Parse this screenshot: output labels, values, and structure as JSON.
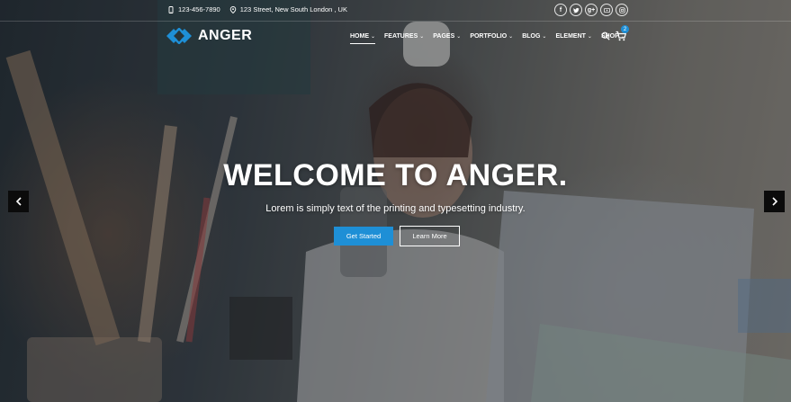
{
  "topbar": {
    "phone": "123-456-7890",
    "address": "123 Street, New South London , UK",
    "social": [
      {
        "icon": "facebook-icon",
        "glyph": "f"
      },
      {
        "icon": "twitter-icon",
        "glyph": "t"
      },
      {
        "icon": "google-plus-icon",
        "glyph": "g+"
      },
      {
        "icon": "youtube-icon",
        "glyph": "▶"
      },
      {
        "icon": "instagram-icon",
        "glyph": "◎"
      }
    ]
  },
  "brand": {
    "name": "ANGER",
    "accent": "#1e8fd6"
  },
  "nav": {
    "items": [
      {
        "label": "HOME",
        "active": true
      },
      {
        "label": "FEATURES"
      },
      {
        "label": "PAGES"
      },
      {
        "label": "PORTFOLIO"
      },
      {
        "label": "BLOG"
      },
      {
        "label": "ELEMENT"
      },
      {
        "label": "SHOP"
      }
    ],
    "cart_count": "2"
  },
  "hero": {
    "title": "WELCOME TO ANGER.",
    "subtitle": "Lorem is simply text of the printing and typesetting industry.",
    "primary_button": "Get Started",
    "secondary_button": "Learn More"
  }
}
